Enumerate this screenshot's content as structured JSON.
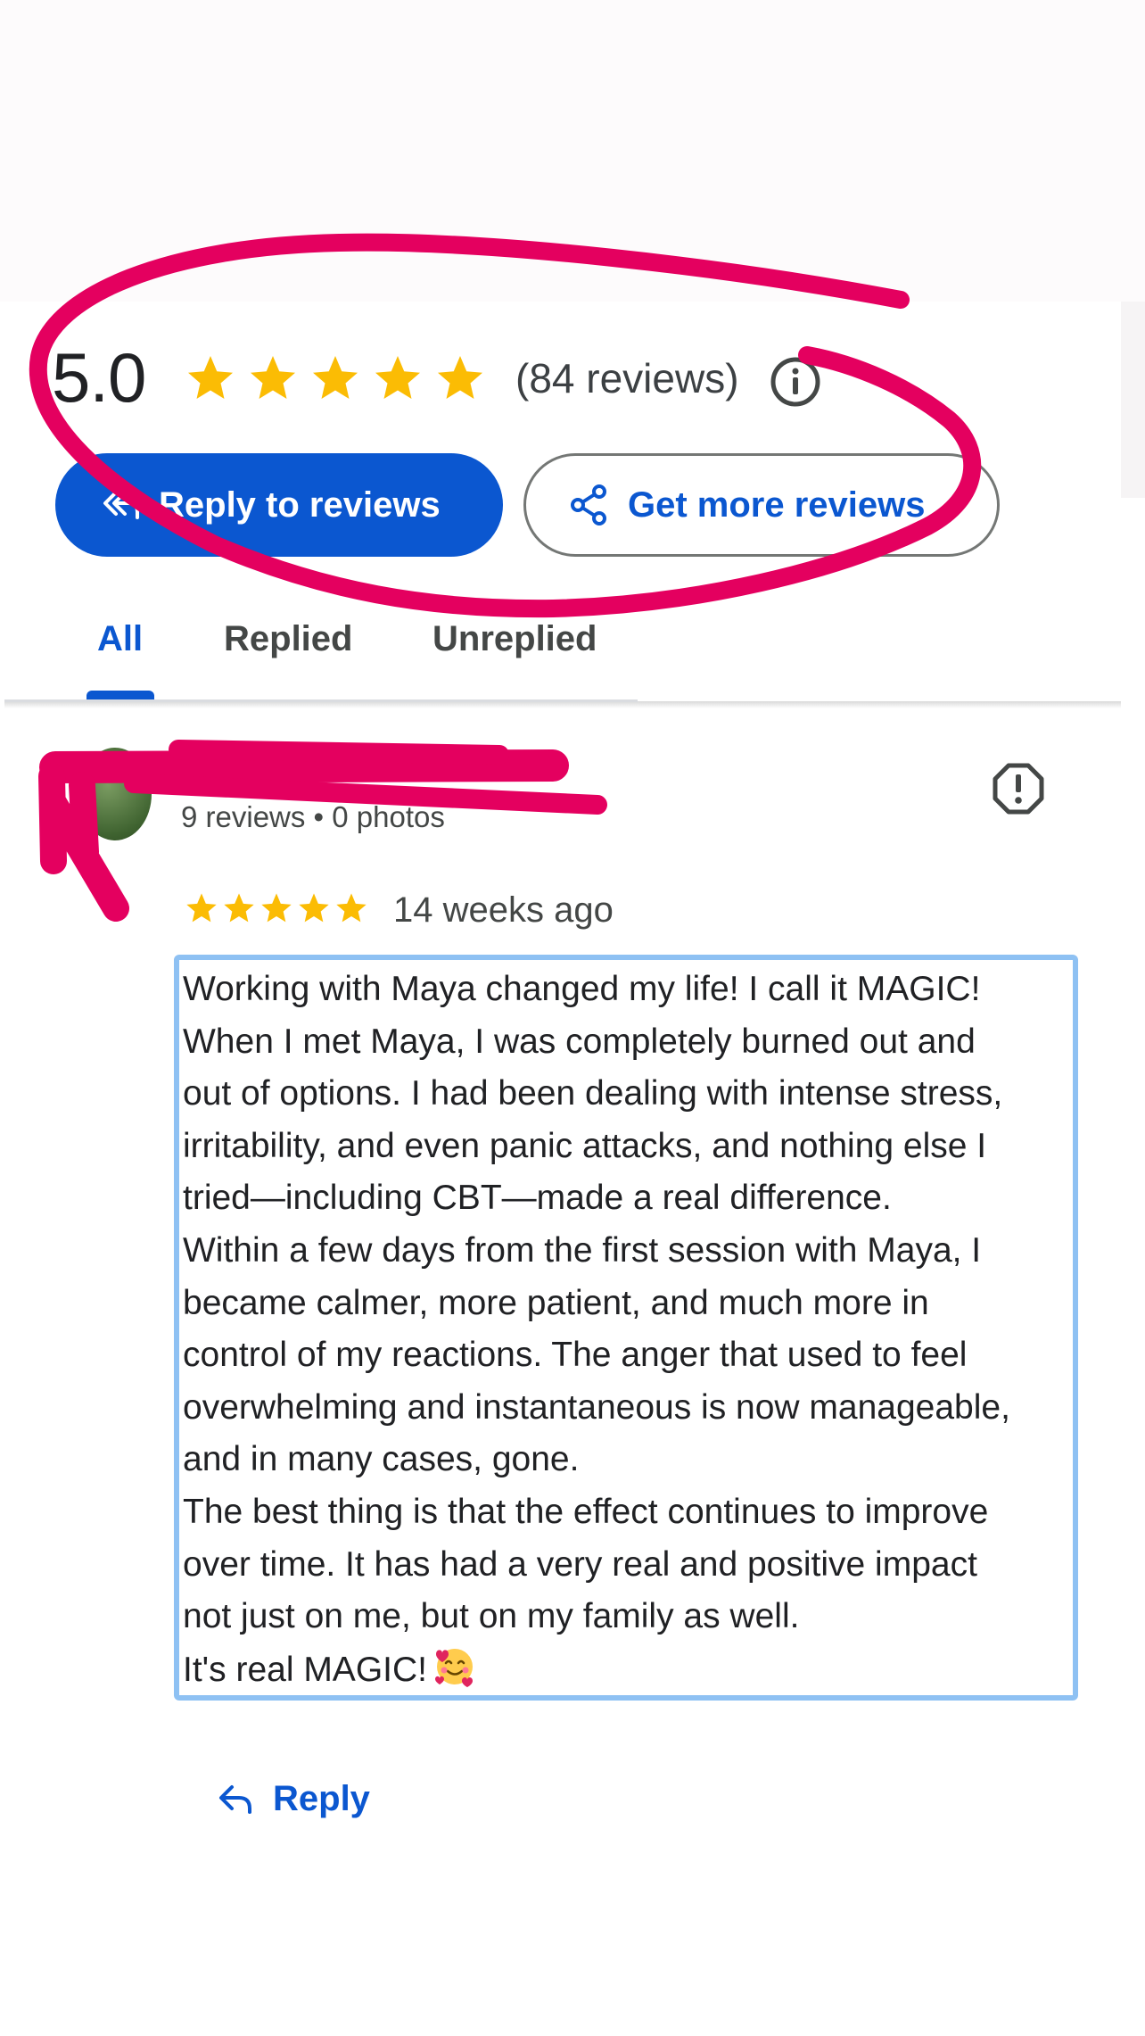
{
  "summary": {
    "rating": "5.0",
    "stars_filled": 5,
    "stars_total": 5,
    "review_count_label": "(84 reviews)",
    "info_icon": "info-icon"
  },
  "actions": {
    "reply_to_reviews_label": "Reply to reviews",
    "reply_icon": "reply-all-icon",
    "get_more_reviews_label": "Get more reviews",
    "share_icon": "share-icon"
  },
  "tabs": [
    {
      "label": "All",
      "active": true
    },
    {
      "label": "Replied",
      "active": false
    },
    {
      "label": "Unreplied",
      "active": false
    }
  ],
  "review": {
    "reviewer_meta": "9 reviews • 0 photos",
    "stars_filled": 5,
    "date": "14 weeks ago",
    "report_icon": "report-icon",
    "text_lines": [
      "Working with Maya changed my life! I call it MAGIC!",
      "When I met Maya, I was completely burned out and",
      "out of options. I had been dealing with intense stress,",
      "irritability, and even panic attacks, and nothing else I",
      "tried—including CBT—made a real difference.",
      "Within a few days from the first session with Maya, I",
      "became calmer, more patient, and much more in",
      "control of my reactions. The anger that used to feel",
      "overwhelming and instantaneous is now manageable,",
      "and in many cases, gone.",
      "The best thing is that the effect continues to improve",
      "over time. It has had a very real and positive impact",
      "not just on me, but on my family as well.",
      "It's real MAGIC!"
    ],
    "emoji": "smiling-face-with-hearts",
    "reply_label": "Reply",
    "reply_icon": "reply-icon"
  },
  "colors": {
    "primary_blue": "#0b57d0",
    "star_gold": "#fbbc04",
    "highlight_border": "#8ec1f3",
    "annotation_ink": "#e4005f"
  }
}
